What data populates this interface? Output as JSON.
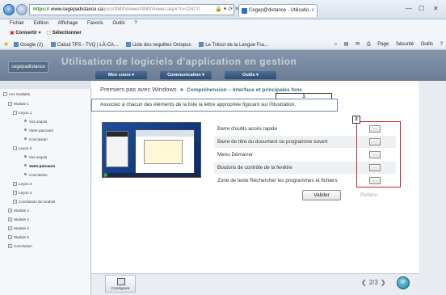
{
  "browser": {
    "url_secure": "https://",
    "url_host": "www.cegepadistance.ca",
    "url_path": "/jocs/SMSViewer/SMSViewer.aspx?c=22427/",
    "tab_title": "Cegep@distance - Utilisatio...",
    "menu": [
      "Fichier",
      "Edition",
      "Affichage",
      "Favoris",
      "Outils",
      "?"
    ],
    "cmd": [
      "Convertir",
      "Sélectionner"
    ],
    "favorites": [
      "Google (2)",
      "Calcul TPS - TVQ | LÀ-CA...",
      "Liste des requêtes Octopus",
      "Le Trésor de la Langue Fra..."
    ],
    "right_tools": [
      "Page",
      "Sécurité",
      "Outils"
    ]
  },
  "header": {
    "logo": "cegepadistance",
    "title": "Utilisation de logiciels d'application en gestion",
    "nav": [
      "Mon cours",
      "Communication",
      "Outils"
    ]
  },
  "sidebar": {
    "items": [
      {
        "label": "Les modules"
      },
      {
        "label": "Module 1"
      },
      {
        "label": "Leçon 1"
      },
      {
        "label": "Vos acquis"
      },
      {
        "label": "Votre parcours"
      },
      {
        "label": "Conclusion"
      },
      {
        "label": "Leçon 2"
      },
      {
        "label": "Vos acquis"
      },
      {
        "label": "Votre parcours"
      },
      {
        "label": "Conclusion"
      },
      {
        "label": "Leçon 3"
      },
      {
        "label": "Leçon 4"
      },
      {
        "label": "Conclusion du module"
      },
      {
        "label": "Module 2"
      },
      {
        "label": "Module 3"
      },
      {
        "label": "Module 4"
      },
      {
        "label": "Module 5"
      },
      {
        "label": "Conclusion"
      }
    ]
  },
  "main": {
    "crumb_title": "Premiers pas avec Windows",
    "crumb_sub": "Compréhension – Interface et principales fonc",
    "callout1": "1",
    "callout2": "2",
    "instruction": "Associez à chacun des éléments de la liste la lettre appropriée figurant sur l'illustration.",
    "items": [
      "Barre d'outils accès rapide",
      "Barre de titre du document ou programme ouvert",
      "Menu Démarrer",
      "Boutons de contrôle de la fenêtre",
      "Zone de texte Rechercher les programmes et fichiers"
    ],
    "answer_placeholder": "...",
    "validate_label": "Valider",
    "redo_label": "Refaire",
    "consignes_label": "Consignes",
    "page_indicator": "2/3"
  }
}
